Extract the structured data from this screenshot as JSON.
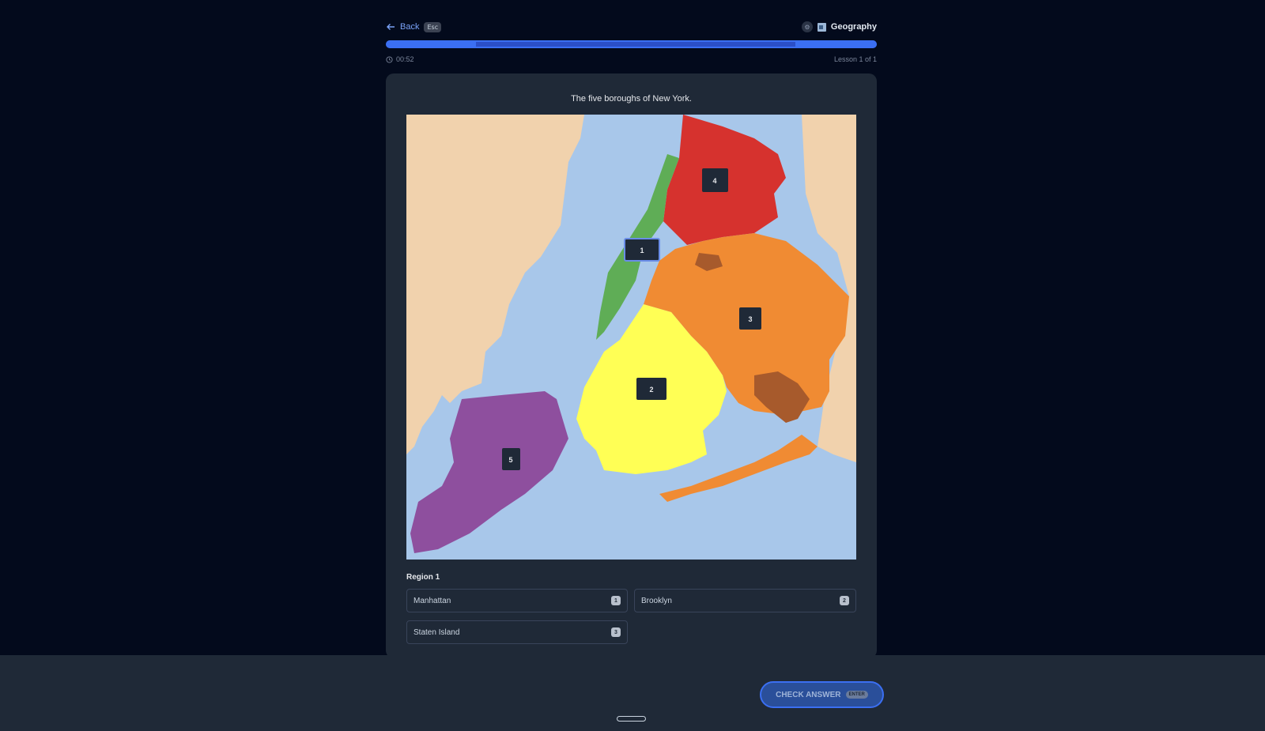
{
  "header": {
    "back_label": "Back",
    "back_key": "Esc",
    "subject": "Geography"
  },
  "progress": {
    "fraction": 1.0
  },
  "meta": {
    "timer": "00:52",
    "lesson": "Lesson 1 of 1"
  },
  "question": {
    "caption": "The five boroughs of New York.",
    "region_title": "Region 1",
    "map_labels": [
      "1",
      "2",
      "3",
      "4",
      "5"
    ],
    "options": [
      {
        "label": "Manhattan",
        "key": "1"
      },
      {
        "label": "Brooklyn",
        "key": "2"
      },
      {
        "label": "Staten Island",
        "key": "3"
      }
    ]
  },
  "footer": {
    "check_label": "CHECK ANSWER",
    "check_key": "ENTER"
  },
  "colors": {
    "manhattan": "#5fad56",
    "bronx": "#d6322e",
    "queens": "#f08b33",
    "brooklyn": "#ffff55",
    "staten_island": "#8e4f9e",
    "land": "#f1d2ad",
    "water": "#a8c7ea",
    "airport": "#a75a2c"
  }
}
